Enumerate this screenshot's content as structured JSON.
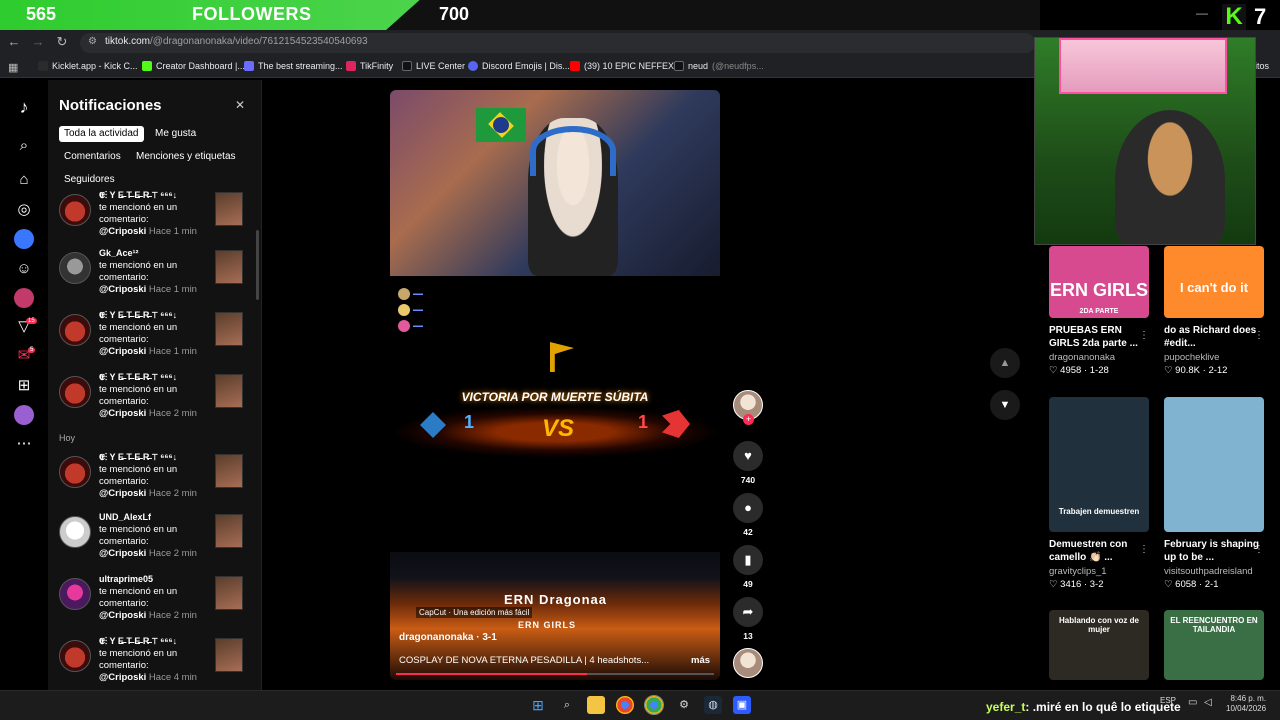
{
  "goal": {
    "current": "565",
    "label": "FOLLOWERS",
    "target": "700",
    "progress": 0.807
  },
  "kick": {
    "count": "7"
  },
  "browser": {
    "url_domain": "tiktok.com",
    "url_path": "/@dragonanonaka/video/7612154523540540693",
    "bookmarks": [
      "Kicklet.app - Kick C...",
      "Creator Dashboard |...",
      "The best streaming...",
      "TikFinity",
      "LIVE Center",
      "Discord Emojis | Dis...",
      "(39) 10 EPIC NEFFEX...",
      "neud",
      "(@neudfps..."
    ],
    "bookmarks_more": "nitos"
  },
  "rail": {
    "badges": [
      "15",
      "5"
    ]
  },
  "notifications": {
    "title": "Notificaciones",
    "filters": [
      "Toda la actividad",
      "Me gusta",
      "Comentarios",
      "Menciones y etiquetas",
      "Seguidores"
    ],
    "section_today": "Hoy",
    "items": [
      {
        "name": "𝕰⋮ Y E̶ T̶ E̶ R̶ ⊤ ⁶⁶⁶↓",
        "text": "te mencionó en un comentario:",
        "mention": "@Criposki",
        "time": "Hace 1 min",
        "avatar": "red"
      },
      {
        "name": "Gk_Ace¹²",
        "text": "te mencionó en un comentario:",
        "mention": "@Criposki",
        "time": "Hace 1 min",
        "avatar": "gray"
      },
      {
        "name": "𝕰⋮ Y E̶ T̶ E̶ R̶ ⊤ ⁶⁶⁶↓",
        "text": "te mencionó en un comentario:",
        "mention": "@Criposki",
        "time": "Hace 1 min",
        "avatar": "red"
      },
      {
        "name": "𝕰⋮ Y E̶ T̶ E̶ R̶ ⊤ ⁶⁶⁶↓",
        "text": "te mencionó en un comentario:",
        "mention": "@Criposki",
        "time": "Hace 2 min",
        "avatar": "red"
      },
      {
        "name": "𝕰⋮ Y E̶ T̶ E̶ R̶ ⊤ ⁶⁶⁶↓",
        "text": "te mencionó en un comentario:",
        "mention": "@Criposki",
        "time": "Hace 2 min",
        "avatar": "red"
      },
      {
        "name": "UND_AlexLf",
        "text": "te mencionó en un comentario:",
        "mention": "@Criposki",
        "time": "Hace 2 min",
        "avatar": "white"
      },
      {
        "name": "ultraprime05",
        "text": "te mencionó en un comentario:",
        "mention": "@Criposki",
        "time": "Hace 2 min",
        "avatar": "purple"
      },
      {
        "name": "𝕰⋮ Y E̶ T̶ E̶ R̶ ⊤ ⁶⁶⁶↓",
        "text": "te mencionó en un comentario:",
        "mention": "@Criposki",
        "time": "Hace 4 min",
        "avatar": "red"
      }
    ]
  },
  "video": {
    "victory_text": "VICTORIA POR MUERTE SÚBITA",
    "score_left": "1",
    "score_right": "1",
    "vs": "VS",
    "overlay_name": "ERN Dragonaa",
    "overlay_sub": "ERN GIRLS",
    "capcut": "CapCut · Una edición más fácil",
    "author": "dragonanonaka · 3-1",
    "caption": "COSPLAY DE NOVA ETERNA PESADILLA | 4 headshots...",
    "more": "más",
    "progress": 0.6
  },
  "actions": {
    "likes": "740",
    "comments": "42",
    "saves": "49",
    "shares": "13"
  },
  "feed": [
    {
      "thumb_text": "ERN GIRLS",
      "thumb_sub": "2DA PARTE",
      "title": "PRUEBAS ERN GIRLS 2da parte ...",
      "author": "dragonanonaka",
      "likes": "4958",
      "date": "1-28",
      "bg": "#d74a8f"
    },
    {
      "thumb_text": "I can't do it",
      "thumb_sub": "",
      "title": "do as Richard does #edit...",
      "author": "pupocheklive",
      "likes": "90.8K",
      "date": "2-12",
      "bg": "#ff8a2b"
    },
    {
      "thumb_text": "Trabajen demuestren",
      "thumb_sub": "",
      "title": "Demuestren con camello 👏🏻 ...",
      "author": "gravityclips_1",
      "likes": "3416",
      "date": "3-2",
      "bg": "#20303d"
    },
    {
      "thumb_text": "",
      "thumb_sub": "",
      "title": "February is shaping up to be ...",
      "author": "visitsouthpadreisland",
      "likes": "6058",
      "date": "2-1",
      "bg": "#7fb3cf"
    },
    {
      "thumb_text": "Hablando con voz de mujer",
      "thumb_sub": "",
      "title": "",
      "author": "",
      "likes": "",
      "date": "",
      "bg": "#2d2a24"
    },
    {
      "thumb_text": "EL REENCUENTRO EN TAILANDIA",
      "thumb_sub": "",
      "title": "",
      "author": "",
      "likes": "",
      "date": "",
      "bg": "#3a6f45"
    }
  ],
  "chat": {
    "user": "yefer_t",
    "message": ": .miré en lo quê lo etiquete"
  },
  "tray": {
    "lang": "ESP",
    "time": "8:46 p. m.",
    "date": "10/04/2026"
  }
}
